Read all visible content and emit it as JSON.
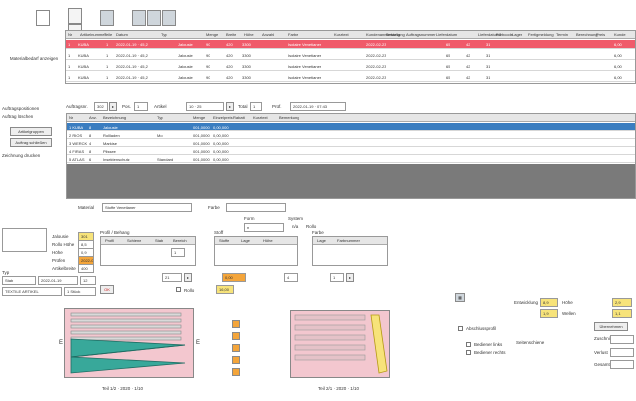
{
  "top_grid": {
    "headers": [
      "Nr",
      "Artikelnummer",
      "Teile",
      "Datum",
      "Typ",
      "Menge",
      "Breite",
      "Höhe",
      "Anzahl",
      "Farbe",
      "Kurztext",
      "Kundenanmerkung",
      "Bestellung",
      "Auftragsnummer",
      "Lieferdatum",
      "Lieferdatum2",
      "Farbcode",
      "Lager",
      "Fertigmeldung",
      "Termin",
      "Berechnung",
      "Preis",
      "Kunde",
      "Länge"
    ],
    "rows": [
      [
        "1",
        "KUBA",
        "1",
        "2022-01-19 · 45,2",
        "Jalousie",
        "90",
        "420",
        "3300",
        "",
        "Isolaire Venetianer",
        "",
        "",
        "",
        "",
        "",
        "2022-02-23",
        "",
        "",
        "65",
        "42",
        "31",
        "6,00"
      ],
      [
        "1",
        "KUBA",
        "1",
        "2022-01-19 · 45,2",
        "Jalousie",
        "90",
        "420",
        "3300",
        "",
        "Isolaire Venetianer",
        "",
        "",
        "",
        "",
        "",
        "2022-02-23",
        "",
        "",
        "65",
        "42",
        "31",
        "6,00"
      ],
      [
        "1",
        "KUBA",
        "1",
        "2022-01-19 · 45,2",
        "Jalousie",
        "90",
        "420",
        "3300",
        "",
        "Isolaire Venetianer",
        "",
        "",
        "",
        "",
        "",
        "2022-02-23",
        "",
        "",
        "65",
        "42",
        "31",
        "6,00"
      ],
      [
        "1",
        "KUBA",
        "1",
        "2022-01-19 · 45,2",
        "Jalousie",
        "90",
        "420",
        "3300",
        "",
        "Isolaire Venetianer",
        "",
        "",
        "",
        "",
        "",
        "2022-02-23",
        "",
        "",
        "65",
        "42",
        "31",
        "6,00"
      ]
    ],
    "left_label": "Materialbedarf anzeigen"
  },
  "filter_bar": {
    "label_from": "Auftragsnr.",
    "from_value": "302",
    "label_pos": "Pos.",
    "pos_value": "1",
    "label_art": "Artikel",
    "art_value": "10 · 25",
    "label_total": "Total",
    "total_value": "1",
    "label_date": "Prüf.",
    "date_value": "2022-01-19 · 07:43"
  },
  "side_menu": [
    "Auftragspositionen",
    "Auftrag löschen",
    "Artikelgruppen",
    "Auftrag schließen",
    "Zeichnung drucken"
  ],
  "mid_grid": {
    "headers": [
      "Nr",
      "Anz.",
      "Bezeichnung",
      "Typ",
      "Menge",
      "Einzelpreis",
      "Rabatt",
      "Kurztext",
      "Bemerkung"
    ],
    "rows": [
      [
        "1 KUBA",
        "8",
        "Jalousie",
        "",
        "001,0000",
        "0,00,000",
        "",
        "",
        ""
      ],
      [
        "2 RIOS",
        "8",
        "Rollladen",
        "Mo",
        "001,0000",
        "0,00,000",
        "",
        "",
        ""
      ],
      [
        "3 WERCK",
        "4",
        "Markise",
        "",
        "001,0000",
        "0,00,000",
        "",
        "",
        ""
      ],
      [
        "4 FIRAS",
        "8",
        "Plissee",
        "",
        "001,0000",
        "0,00,000",
        "",
        "",
        ""
      ],
      [
        "5 ATLAS",
        "6",
        "Insektenschutz",
        "Standard",
        "001,0000",
        "0,00,000",
        "",
        "",
        ""
      ]
    ]
  },
  "status_row": {
    "label_left": "Material",
    "value_left": "Stoffe Venetianer",
    "label_right": "Farbe"
  },
  "props": {
    "form_label": "Form",
    "form_value": "n",
    "system_label": "System",
    "sys_a": "n/a",
    "sys_b": "Rollo",
    "left_labels": [
      "Jalousie",
      "Rollo Höhe",
      "Höhe",
      "Prüfen",
      "Artikelbreite"
    ],
    "left_values": [
      "301",
      "8,5",
      "0,9",
      "2022-01",
      "400"
    ],
    "sect1_label": "Profil / Behang",
    "sect1_cols": [
      "Profil",
      "Schiene",
      "Stab",
      "Bereich"
    ],
    "sect2_label": "Stoff",
    "sect2_cols": [
      "Stoffe",
      "Lage",
      "Höhe"
    ],
    "sect3_label": "Farbe",
    "sect3_cols": [
      "Lage",
      "Farbnummer"
    ],
    "sel_label": "Typ",
    "sel_value": "Stab",
    "date_value": "2022-01-19",
    "count_value": "12",
    "artno_value": "TEXTILE ARTIKEL",
    "unit_value": "1 Stück",
    "button_ok": "OK",
    "calc_value": "Rollo",
    "field_a": "21",
    "field_b": "4",
    "field_c": "1",
    "field_y": "16,00",
    "field_o": "0,00"
  },
  "right_panel": {
    "labels": [
      "Entwicklung",
      "Höhe",
      "Wellen",
      "Breite"
    ],
    "values": [
      "8,9",
      "1,9",
      "2,9",
      "1,1"
    ],
    "checks": [
      "Abschlussprofil",
      "Bediener links",
      "Bediener rechts",
      "Seitenschiene"
    ],
    "button": "Übernehmen",
    "notes": [
      "Zuschnittmaß",
      "Verlust",
      "Gesamt"
    ]
  },
  "drawings": {
    "left_caption": "Teil 1/2 · 2020 · 1/10",
    "right_caption": "Teil 2/1 · 2020 · 1/10"
  },
  "colors": {
    "red": "#f05a6a",
    "blue": "#3a7dc0",
    "yellow": "#f7e37a",
    "teal": "#38a89a",
    "pink": "#f3c7cf",
    "orange": "#f4a53a"
  }
}
